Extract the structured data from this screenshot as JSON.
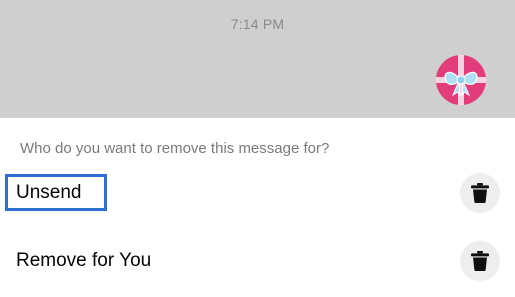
{
  "chat": {
    "timestamp": "7:14 PM",
    "sticker_icon": "gift-bow-sticker"
  },
  "sheet": {
    "prompt": "Who do you want to remove this message for?",
    "options": [
      {
        "label": "Unsend",
        "icon": "trash-icon",
        "highlighted": true
      },
      {
        "label": "Remove for You",
        "icon": "trash-icon",
        "highlighted": false
      }
    ]
  },
  "colors": {
    "chat_background": "#cfcfcf",
    "highlight_border": "#2d6fd3",
    "sticker_pink": "#e23d7a",
    "bow_blue": "#aee0f5"
  }
}
